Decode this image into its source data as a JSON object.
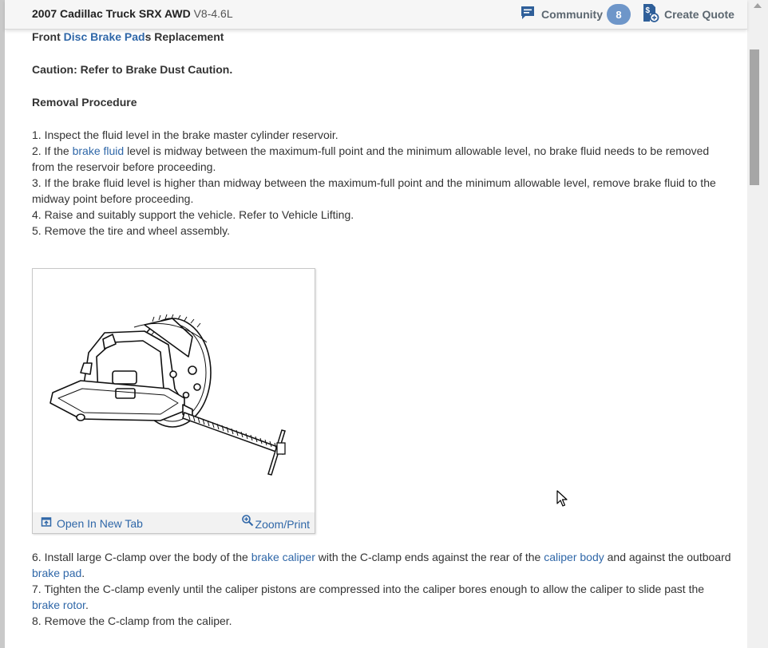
{
  "header": {
    "vehicle_name": "2007 Cadillac Truck SRX AWD",
    "vehicle_engine": "V8-4.6L",
    "community_label": "Community",
    "community_count": "8",
    "quote_label": "Create Quote"
  },
  "article": {
    "title_prefix": "Front ",
    "title_link": "Disc Brake Pad",
    "title_suffix": "s Replacement",
    "caution": "Caution: Refer to Brake Dust Caution.",
    "section": "Removal Procedure",
    "step1": " 1. Inspect the fluid level in the brake master cylinder reservoir.",
    "step2_a": " 2. If the ",
    "step2_link": "brake fluid",
    "step2_b": " level is midway between the maximum-full point and the minimum allowable level, no brake fluid needs to be removed from the reservoir before proceeding.",
    "step3": " 3. If the brake fluid level is higher than midway between the maximum-full point and the minimum allowable level, remove brake fluid to the midway point before proceeding.",
    "step4": " 4. Raise and suitably support the vehicle. Refer to Vehicle Lifting.",
    "step5": " 5. Remove the tire and wheel assembly.",
    "step6_a": " 6. Install large C-clamp over the body of the ",
    "step6_link1": "brake caliper",
    "step6_b": " with the C-clamp ends against the rear of the ",
    "step6_link2": "caliper body",
    "step6_c": " and against the outboard ",
    "step6_link3": "brake pad",
    "step6_d": ".",
    "step7_a": " 7. Tighten the C-clamp evenly until the caliper pistons are compressed into the caliper bores enough to allow the caliper to slide past the ",
    "step7_link": "brake rotor",
    "step7_b": ".",
    "step8": " 8. Remove the C-clamp from the caliper."
  },
  "figure": {
    "open_tab_label": "Open In New Tab",
    "zoom_label": "Zoom/Print"
  },
  "colors": {
    "link": "#2f67a8",
    "badge": "#6e96c9",
    "header_bg": "#f6f6f6"
  },
  "icons": {
    "community": "chat-bubble-icon",
    "quote": "dollar-document-icon",
    "open_tab": "open-new-tab-icon",
    "zoom": "magnifier-plus-icon"
  }
}
